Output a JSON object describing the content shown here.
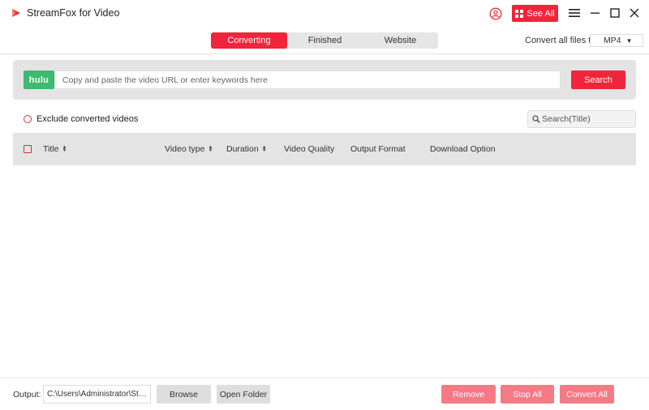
{
  "app": {
    "title": "StreamFox for Video",
    "see_all_label": "See All",
    "accent_color": "#f0243b"
  },
  "tabs": [
    {
      "label": "Converting",
      "active": true
    },
    {
      "label": "Finished",
      "active": false
    },
    {
      "label": "Website",
      "active": false
    }
  ],
  "convert_all": {
    "label": "Convert all files to:",
    "format": "MP4"
  },
  "search_bar": {
    "service_badge": "hulu",
    "service_color": "#3dba6f",
    "placeholder": "Copy and paste the video URL or enter keywords here",
    "value": "",
    "button_label": "Search"
  },
  "filter": {
    "exclude_label": "Exclude converted videos",
    "title_search_placeholder": "Search(Title)"
  },
  "table": {
    "columns": [
      "Title",
      "Video type",
      "Duration",
      "Video Quality",
      "Output Format",
      "Download Option"
    ],
    "rows": []
  },
  "footer": {
    "output_label": "Output:",
    "output_path": "C:\\Users\\Administrator\\StreamFox for Video",
    "browse_label": "Browse",
    "open_folder_label": "Open Folder",
    "remove_label": "Remove",
    "stop_all_label": "Stop All",
    "convert_all_label": "Convert All"
  },
  "icons": [
    "app-logo-icon",
    "user-icon",
    "grid-icon",
    "menu-icon",
    "minimize-icon",
    "maximize-icon",
    "close-icon",
    "search-icon",
    "sort-icon"
  ]
}
